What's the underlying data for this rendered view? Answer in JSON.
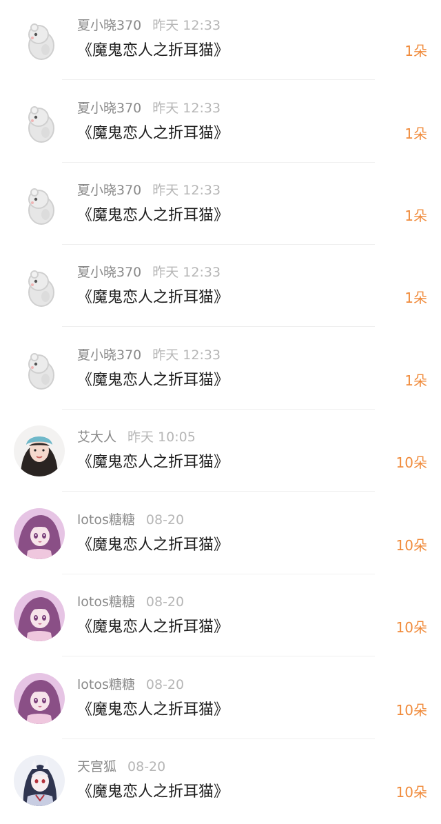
{
  "gifts": [
    {
      "user": "夏小晓370",
      "time": "昨天 12:33",
      "work": "《魔鬼恋人之折耳猫》",
      "amount": "1朵",
      "avatar": "hamster-icon"
    },
    {
      "user": "夏小晓370",
      "time": "昨天 12:33",
      "work": "《魔鬼恋人之折耳猫》",
      "amount": "1朵",
      "avatar": "hamster-icon"
    },
    {
      "user": "夏小晓370",
      "time": "昨天 12:33",
      "work": "《魔鬼恋人之折耳猫》",
      "amount": "1朵",
      "avatar": "hamster-icon"
    },
    {
      "user": "夏小晓370",
      "time": "昨天 12:33",
      "work": "《魔鬼恋人之折耳猫》",
      "amount": "1朵",
      "avatar": "hamster-icon"
    },
    {
      "user": "夏小晓370",
      "time": "昨天 12:33",
      "work": "《魔鬼恋人之折耳猫》",
      "amount": "1朵",
      "avatar": "hamster-icon"
    },
    {
      "user": "艾大人",
      "time": "昨天 10:05",
      "work": "《魔鬼恋人之折耳猫》",
      "amount": "10朵",
      "avatar": "girl-photo-avatar"
    },
    {
      "user": "lotos糖糖",
      "time": "08-20",
      "work": "《魔鬼恋人之折耳猫》",
      "amount": "10朵",
      "avatar": "anime-girl-avatar"
    },
    {
      "user": "lotos糖糖",
      "time": "08-20",
      "work": "《魔鬼恋人之折耳猫》",
      "amount": "10朵",
      "avatar": "anime-girl-avatar"
    },
    {
      "user": "lotos糖糖",
      "time": "08-20",
      "work": "《魔鬼恋人之折耳猫》",
      "amount": "10朵",
      "avatar": "anime-girl-avatar"
    },
    {
      "user": "天宫狐",
      "time": "08-20",
      "work": "《魔鬼恋人之折耳猫》",
      "amount": "10朵",
      "avatar": "anime-fox-avatar"
    }
  ],
  "colors": {
    "amount": "#f08a3a",
    "name": "#8a8a8a",
    "time": "#b6b6b6",
    "title": "#1f1f1f"
  }
}
